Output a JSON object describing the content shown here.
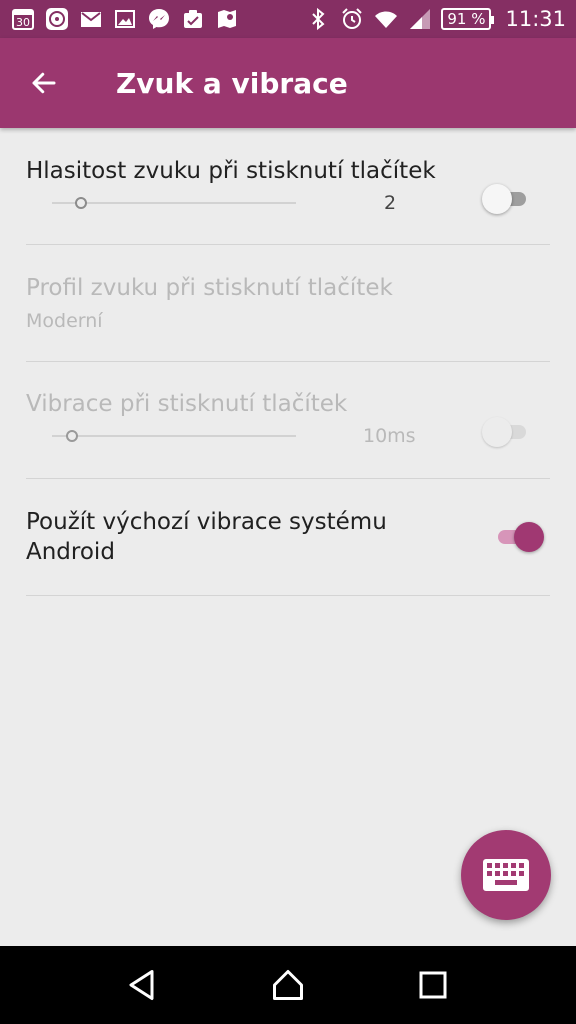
{
  "status_bar": {
    "icons": [
      "calendar-icon",
      "mi-fit-icon",
      "gmail-icon",
      "gallery-icon",
      "messenger-icon",
      "task-icon",
      "maps-icon",
      "bluetooth-icon",
      "alarm-icon",
      "wifi-icon",
      "signal-icon"
    ],
    "calendar_day": "30",
    "battery": "91 %",
    "time": "11:31"
  },
  "app_bar": {
    "title": "Zvuk a vibrace"
  },
  "settings": [
    {
      "title": "Hlasitost zvuku při stisknutí tlačítek",
      "slider_value": "2",
      "slider_level": 0.12,
      "switch_on": false,
      "enabled": true
    },
    {
      "title": "Profil zvuku při stisknutí tlačítek",
      "subtitle": "Moderní",
      "enabled": false
    },
    {
      "title": "Vibrace při stisknutí tlačítek",
      "slider_value": "10ms",
      "slider_level": 0.08,
      "switch_on": false,
      "enabled": false
    },
    {
      "title_line1": "Použít výchozí vibrace systému",
      "title_line2": "Android",
      "switch_on": true,
      "enabled": true
    }
  ],
  "fab": {
    "icon": "keyboard-icon"
  },
  "nav_bar": {
    "icons": [
      "back-nav-icon",
      "home-icon",
      "recents-icon"
    ]
  },
  "colors": {
    "status_bar": "#852f63",
    "app_bar": "#9b376f",
    "accent": "#a03872",
    "background": "#ececec"
  }
}
